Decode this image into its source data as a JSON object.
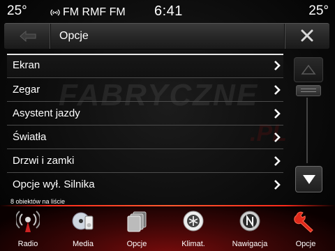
{
  "status": {
    "temp_left": "25°",
    "radio": "FM RMF FM",
    "time": "6:41",
    "temp_right": "25°"
  },
  "header": {
    "title": "Opcje",
    "back_icon": "back-arrow-icon",
    "close_icon": "close-icon"
  },
  "list": {
    "items": [
      {
        "label": "Ekran",
        "selected": true
      },
      {
        "label": "Zegar"
      },
      {
        "label": "Asystent jazdy"
      },
      {
        "label": "Światła"
      },
      {
        "label": "Drzwi i zamki"
      },
      {
        "label": "Opcje wył. Silnika"
      }
    ],
    "count_text": "8 obiektów na liście"
  },
  "watermark": {
    "main": "FABRYCZNE",
    "sub": ".PL"
  },
  "nav": {
    "items": [
      {
        "label": "Radio",
        "icon": "radio-icon"
      },
      {
        "label": "Media",
        "icon": "media-icon"
      },
      {
        "label": "Opcje",
        "icon": "opcje-cards-icon"
      },
      {
        "label": "Klimat.",
        "icon": "climate-icon"
      },
      {
        "label": "Nawigacja",
        "icon": "compass-icon"
      },
      {
        "label": "Opcje",
        "icon": "wrench-icon",
        "active": true
      }
    ]
  },
  "colors": {
    "accent_red": "#e0281a",
    "nav_glow": "#7a0c0c",
    "text": "#ffffff"
  }
}
